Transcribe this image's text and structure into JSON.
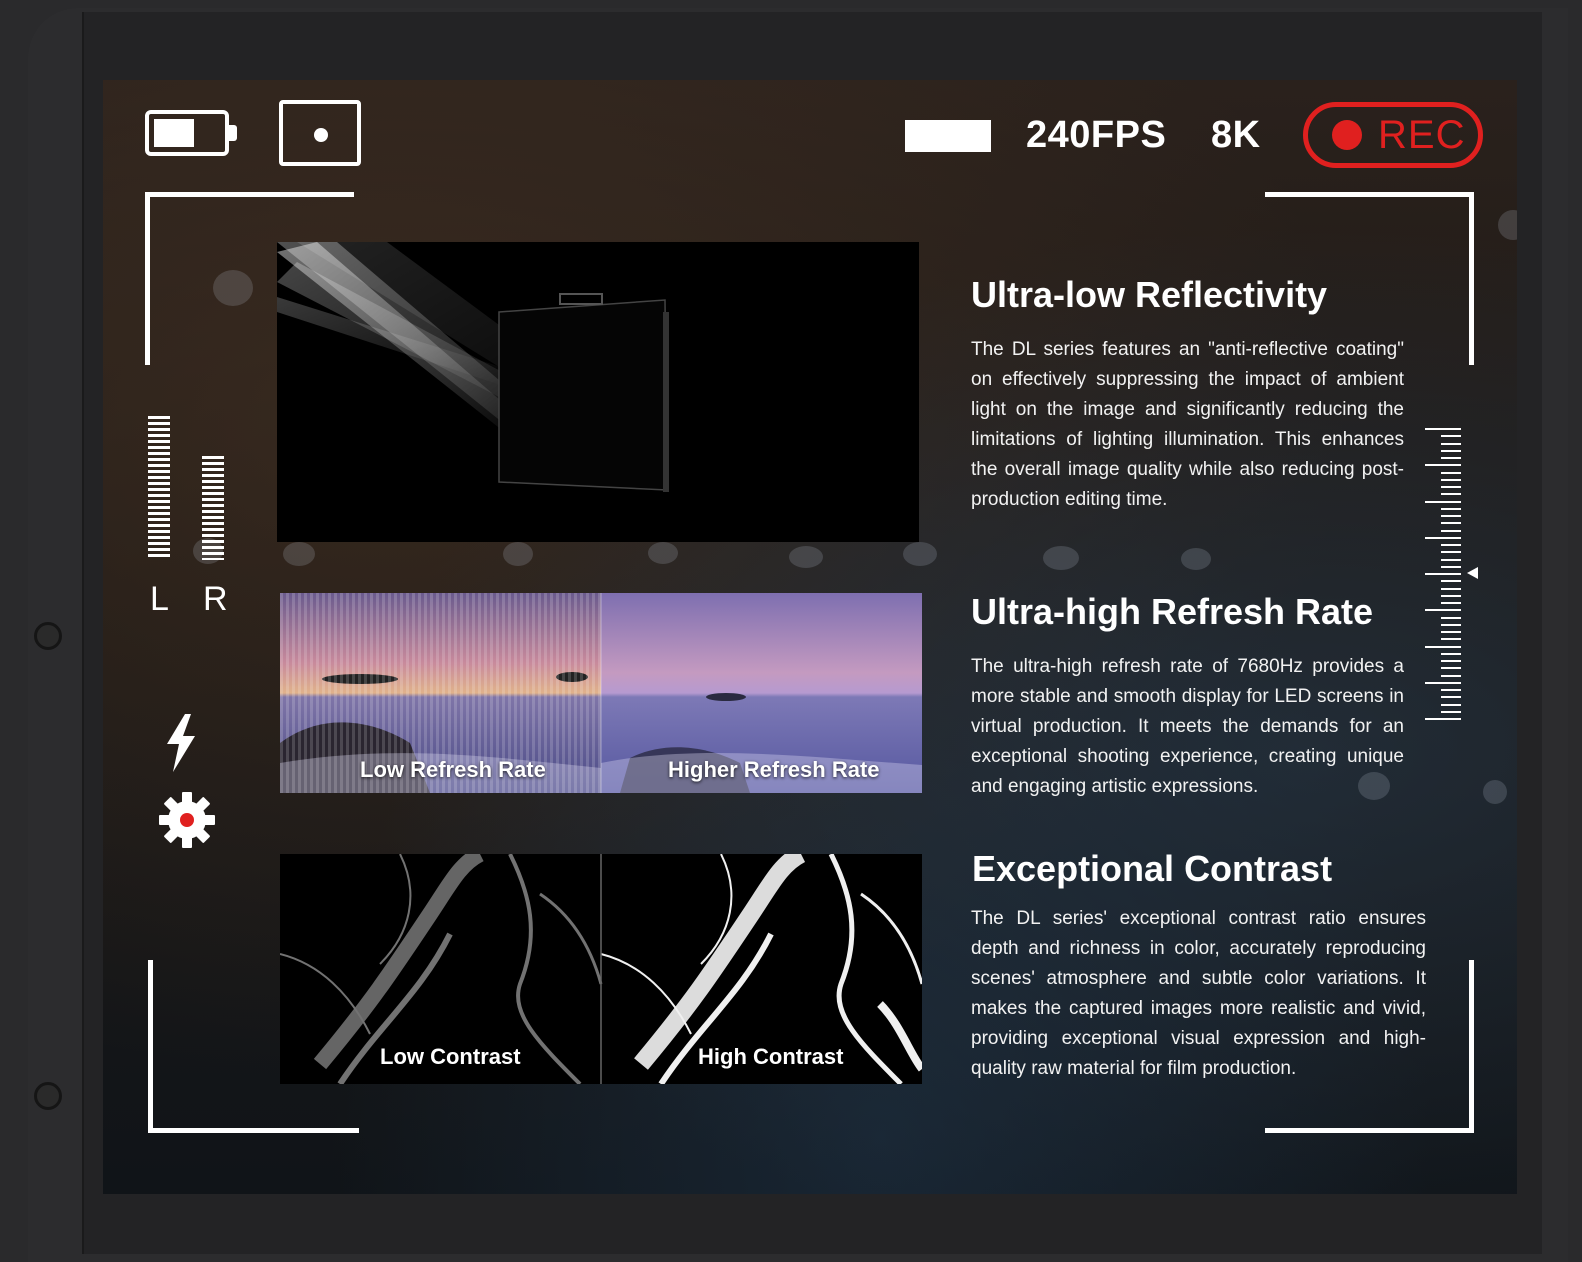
{
  "camera_hud": {
    "fps": "240FPS",
    "resolution": "8K",
    "rec_label": "REC",
    "rec_color": "#e0201f",
    "battery_level": 0.6,
    "audio_meters": {
      "left_label": "L",
      "right_label": "R",
      "left_level": 0.9,
      "right_level": 0.65
    }
  },
  "icons": {
    "battery": "battery-icon",
    "focus": "focus-frame-icon",
    "flash": "lightning-bolt-icon",
    "settings": "gear-icon",
    "level_marker": "triangle-pointer-icon"
  },
  "panels": {
    "refresh_rate": {
      "low_label": "Low Refresh Rate",
      "high_label": "Higher Refresh Rate"
    },
    "contrast": {
      "low_label": "Low Contrast",
      "high_label": "High Contrast"
    }
  },
  "features": [
    {
      "title": "Ultra-low Reflectivity",
      "body": "The DL series features an \"anti-reflective coating\" on effectively suppressing the impact of ambient light on the image and significantly reducing the limitations of lighting illumination. This enhances the overall image quality while also reducing post-production editing time."
    },
    {
      "title": "Ultra-high Refresh Rate",
      "body": "The ultra-high refresh rate of 7680Hz provides a more stable and smooth display for LED screens in virtual production. It meets the demands for an exceptional shooting experience, creating unique and engaging artistic expressions."
    },
    {
      "title": "Exceptional Contrast",
      "body": "The DL series' exceptional contrast ratio ensures depth and richness in color, accurately reproducing scenes' atmosphere and subtle color variations. It makes the captured images more realistic and vivid, providing exceptional visual expression and high-quality raw material for film production."
    }
  ]
}
